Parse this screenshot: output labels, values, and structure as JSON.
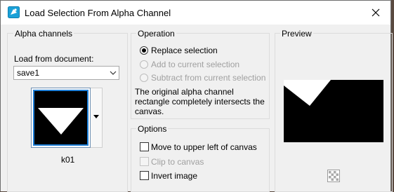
{
  "window": {
    "title": "Load Selection From Alpha Channel"
  },
  "alpha": {
    "group_title": "Alpha channels",
    "load_label": "Load from document:",
    "document_value": "save1",
    "channel_name": "k01"
  },
  "operation": {
    "group_title": "Operation",
    "options": [
      {
        "label": "Replace selection",
        "checked": true,
        "enabled": true
      },
      {
        "label": "Add to current selection",
        "checked": false,
        "enabled": false
      },
      {
        "label": "Subtract from current selection",
        "checked": false,
        "enabled": false
      }
    ],
    "message": "The original alpha channel rectangle completely intersects the canvas."
  },
  "options": {
    "group_title": "Options",
    "items": [
      {
        "label": "Move to upper left of canvas",
        "checked": false,
        "enabled": true
      },
      {
        "label": "Clip to canvas",
        "checked": false,
        "enabled": false
      },
      {
        "label": "Invert image",
        "checked": false,
        "enabled": true
      }
    ]
  },
  "preview": {
    "group_title": "Preview"
  },
  "icons": {
    "app": "psp-app-icon",
    "close": "close-icon",
    "dropdown": "chevron-down-icon",
    "zoom": "checkerboard-zoom-icon"
  },
  "colors": {
    "selection_highlight": "#1e7fd8",
    "preview_bg": "#000000",
    "shape": "#ffffff"
  }
}
